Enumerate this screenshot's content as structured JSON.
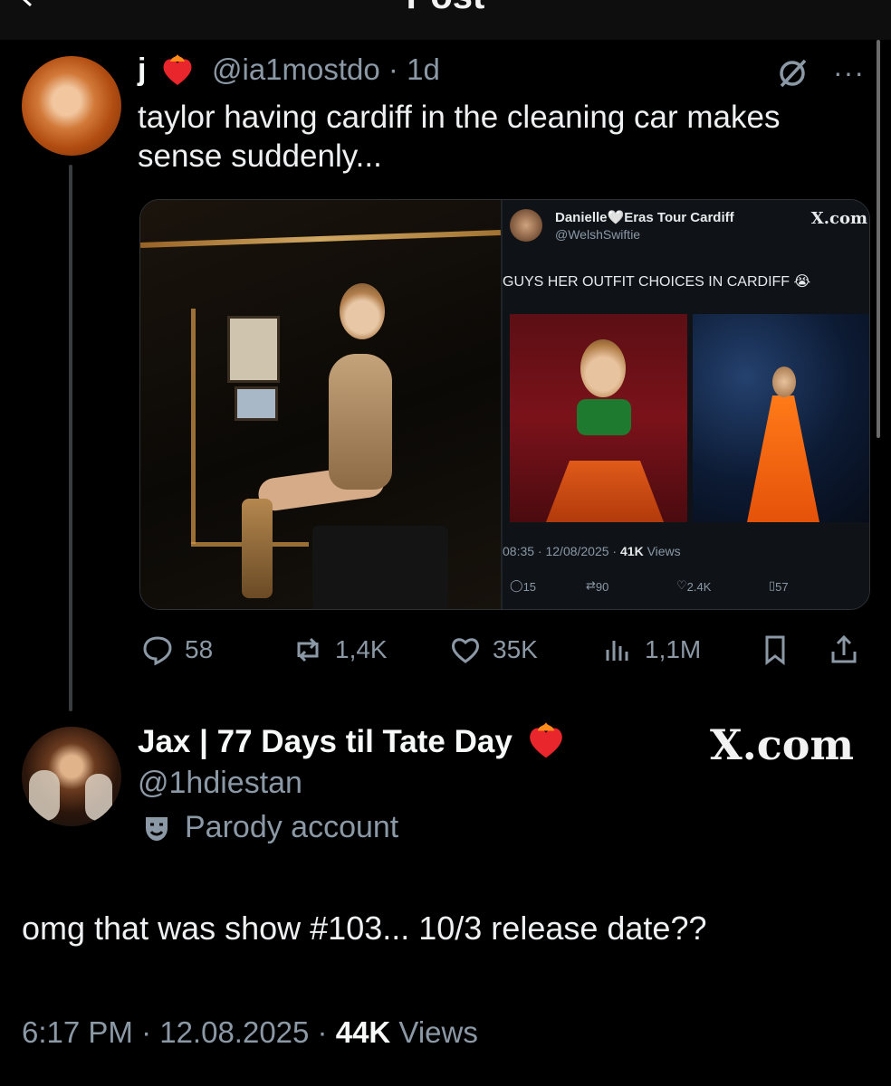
{
  "header": {
    "title": "Post"
  },
  "tweet1": {
    "name": "j",
    "handle": "@ia1mostdo",
    "time": "1d",
    "text": "taylor having cardiff in the cleaning car makes sense suddenly...",
    "embed": {
      "name": "Danielle🤍Eras Tour Cardiff",
      "handle": "@WelshSwiftie",
      "brand": "X.com",
      "caption": "GUYS HER OUTFIT CHOICES IN CARDIFF 😭",
      "time": "08:35 · 12/08/2025 · ",
      "views_count": "41K",
      "views_label": "Views",
      "actions": {
        "replies": "15",
        "reposts": "90",
        "likes": "2.4K",
        "bookmarks": "57"
      }
    },
    "actions": {
      "replies": "58",
      "reposts": "1,4K",
      "likes": "35K",
      "views": "1,1M"
    }
  },
  "tweet2": {
    "name": "Jax | 77 Days til Tate Day",
    "brand": "X.com",
    "handle": "@1hdiestan",
    "parody_label": "Parody account",
    "text": "omg that was show #103... 10/3 release date??",
    "timestamp": "6:17 PM · 12.08.2025 · ",
    "views_count": "44K",
    "views_label": " Views"
  },
  "colors": {
    "background": "#000000",
    "muted": "#8b98a5",
    "text": "#e7e9ea",
    "heart_red": "#f91880"
  },
  "icons": [
    "back-arrow-icon",
    "grok-icon",
    "more-icon",
    "reply-icon",
    "repost-icon",
    "like-icon",
    "views-icon",
    "bookmark-icon",
    "share-icon",
    "heart-on-fire-emoji",
    "parody-mask-icon"
  ]
}
